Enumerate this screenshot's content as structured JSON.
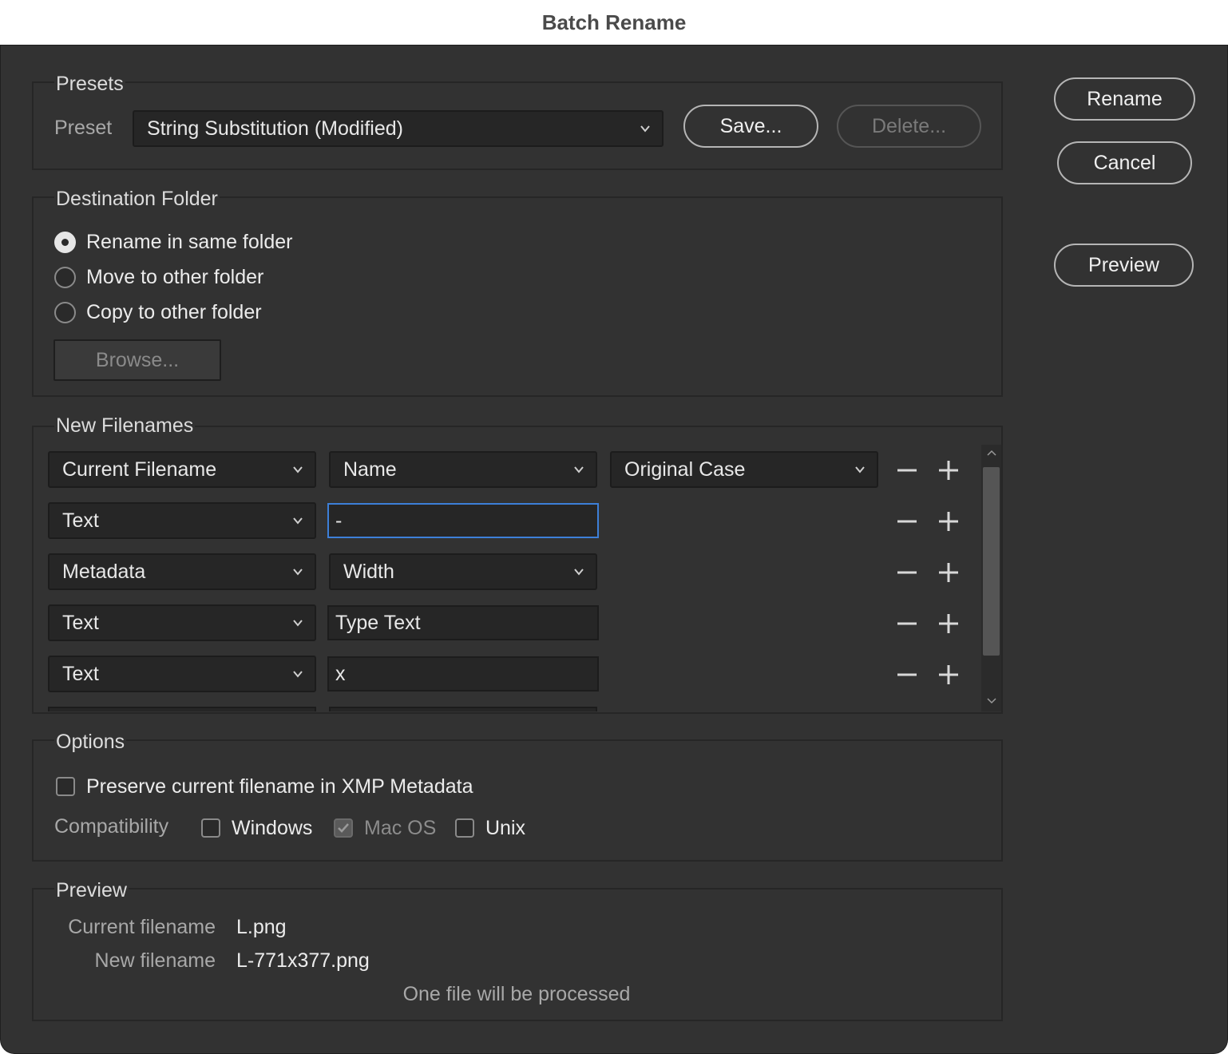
{
  "window": {
    "title": "Batch Rename"
  },
  "actions": {
    "rename": "Rename",
    "cancel": "Cancel",
    "preview": "Preview"
  },
  "presets": {
    "group_label": "Presets",
    "preset_label": "Preset",
    "preset_value": "String Substitution (Modified)",
    "save": "Save...",
    "delete": "Delete..."
  },
  "destination": {
    "group_label": "Destination Folder",
    "options": [
      {
        "label": "Rename in same folder",
        "selected": true
      },
      {
        "label": "Move to other folder",
        "selected": false
      },
      {
        "label": "Copy to other folder",
        "selected": false
      }
    ],
    "browse": "Browse..."
  },
  "new_filenames": {
    "group_label": "New Filenames",
    "rows": [
      {
        "type": "Current Filename",
        "field": "Name",
        "field_kind": "select",
        "extra": "Original Case"
      },
      {
        "type": "Text",
        "field": "-",
        "field_kind": "text",
        "focused": true
      },
      {
        "type": "Metadata",
        "field": "Width",
        "field_kind": "select"
      },
      {
        "type": "Text",
        "field": "Type Text",
        "field_kind": "text"
      },
      {
        "type": "Text",
        "field": "x",
        "field_kind": "text"
      }
    ]
  },
  "options": {
    "group_label": "Options",
    "preserve_label": "Preserve current filename in XMP Metadata",
    "preserve_checked": false,
    "compat_label": "Compatibility",
    "windows": "Windows",
    "macos": "Mac OS",
    "unix": "Unix"
  },
  "preview": {
    "group_label": "Preview",
    "current_label": "Current filename",
    "current_value": "L.png",
    "new_label": "New filename",
    "new_value": "L-771x377.png",
    "summary": "One file will be processed"
  }
}
